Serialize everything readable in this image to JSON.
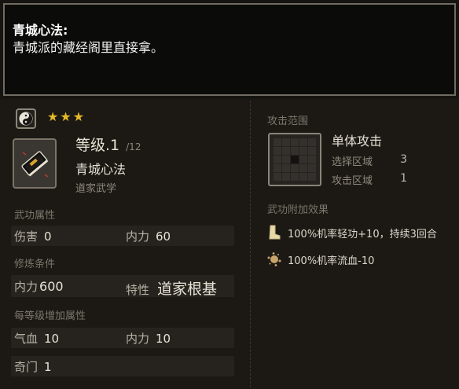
{
  "tooltip": {
    "title": "青城心法:",
    "description": "青城派的藏经阁里直接拿。"
  },
  "skill": {
    "school_icon": "yin-yang-icon",
    "stars": 3,
    "icon": "book-icon",
    "level_label": "等级.1",
    "level_max": "/12",
    "name": "青城心法",
    "category": "道家武学"
  },
  "sections": {
    "martial_attr_label": "武功属性",
    "train_cond_label": "修炼条件",
    "per_level_label": "每等级增加属性",
    "attack_range_label": "攻击范围",
    "extra_effects_label": "武功附加效果"
  },
  "martial_attrs": {
    "damage": {
      "key": "伤害",
      "value": "0"
    },
    "inner_power": {
      "key": "内力",
      "value": "60"
    }
  },
  "train_conditions": {
    "inner_power": {
      "key": "内力",
      "value": "600"
    },
    "trait": {
      "key": "特性",
      "value": "道家根基"
    }
  },
  "per_level": {
    "qixue": {
      "key": "气血",
      "value": "10"
    },
    "neili": {
      "key": "内力",
      "value": "10"
    },
    "qimen": {
      "key": "奇门",
      "value": "1"
    }
  },
  "attack_range": {
    "type": "单体攻击",
    "select_area": {
      "label": "选择区域",
      "value": "3"
    },
    "attack_area": {
      "label": "攻击区域",
      "value": "1"
    },
    "grid_size": 5,
    "selected_cells": [
      12
    ]
  },
  "effects": [
    {
      "icon": "boot-icon",
      "text": "100%机率轻功+10，持续3回合"
    },
    {
      "icon": "blood-splat-icon",
      "text": "100%机率流血-10"
    }
  ],
  "colors": {
    "star": "#e5b92a",
    "boot": "#e8d9a8",
    "blood": "#c9a46a"
  }
}
